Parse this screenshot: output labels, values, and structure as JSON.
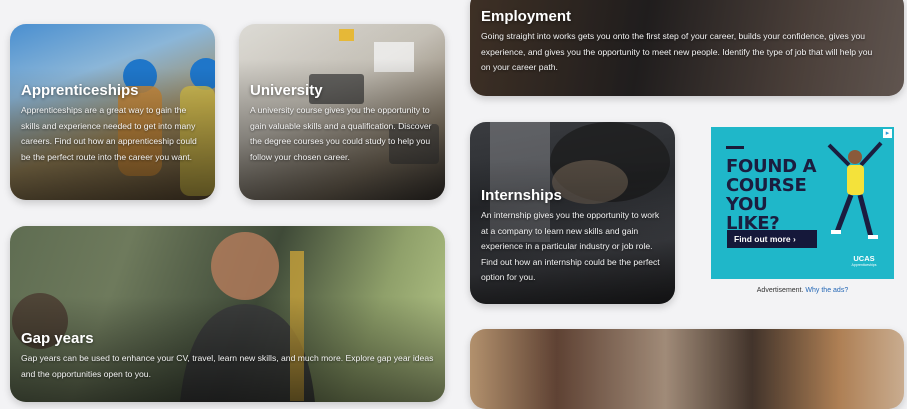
{
  "cards": {
    "apprenticeships": {
      "title": "Apprenticeships",
      "description": "Apprenticeships are a great way to gain the skills and experience needed to get into many careers. Find out how an apprenticeship could be the perfect route into the career you want."
    },
    "university": {
      "title": "University",
      "description": "A university course gives you the opportunity to gain valuable skills and a qualification. Discover the degree courses you could study to help you follow your chosen career."
    },
    "employment": {
      "title": "Employment",
      "description": "Going straight into works gets you onto the first step of your career, builds your confidence, gives you experience, and gives you the opportunity to meet new people. Identify the type of job that will help you on your career path."
    },
    "internships": {
      "title": "Internships",
      "description": "An internship gives you the opportunity to work at a company to learn new skills and gain experience in a particular industry or job role. Find out how an internship could be the perfect option for you."
    },
    "gap_years": {
      "title": "Gap years",
      "description": "Gap years can be used to enhance your CV, travel, learn new skills, and much more. Explore gap year ideas and the opportunities open to you."
    }
  },
  "advertisement": {
    "headline": "FOUND A COURSE YOU LIKE?",
    "cta_label": "Find out more ›",
    "brand": "UCAS",
    "brand_sub": "Apprenticeships",
    "adchoices_glyph": "▸",
    "caption": "Advertisement.",
    "why_link": "Why the ads?",
    "colors": {
      "background": "#1fb7c9",
      "headline": "#1b1d3f",
      "cta": "#15183a"
    }
  }
}
